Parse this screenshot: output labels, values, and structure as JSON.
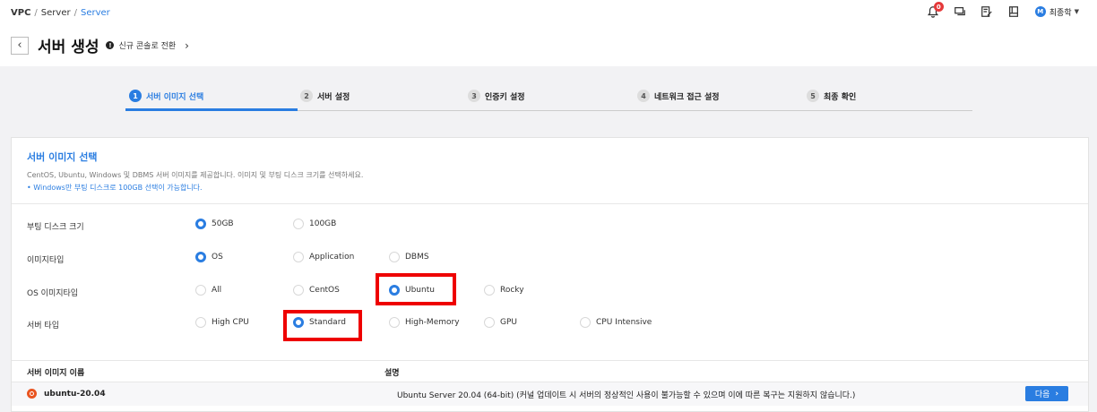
{
  "breadcrumb": {
    "items": [
      "VPC",
      "Server",
      "Server"
    ],
    "separator": "/"
  },
  "header": {
    "title": "서버 생성",
    "console_link": "신규 콘솔로 전환"
  },
  "topbar": {
    "notification_count": "0",
    "user_initial": "M",
    "user_name": "최종학"
  },
  "steps": [
    {
      "num": "1",
      "label": "서버 이미지 선택"
    },
    {
      "num": "2",
      "label": "서버 설정"
    },
    {
      "num": "3",
      "label": "인증키 설정"
    },
    {
      "num": "4",
      "label": "네트워크 접근 설정"
    },
    {
      "num": "5",
      "label": "최종 확인"
    }
  ],
  "section": {
    "title": "서버 이미지 선택",
    "description": "CentOS, Ubuntu, Windows 및 DBMS 서버 이미지를 제공합니다. 이미지 및 부팅 디스크 크기를 선택하세요.",
    "note": "• Windows만 부팅 디스크로 100GB 선택이 가능합니다."
  },
  "form": {
    "disk": {
      "label": "부팅 디스크 크기",
      "options": [
        "50GB",
        "100GB"
      ],
      "selected": "50GB"
    },
    "image_type": {
      "label": "이미지타입",
      "options": [
        "OS",
        "Application",
        "DBMS"
      ],
      "selected": "OS"
    },
    "os_type": {
      "label": "OS 이미지타입",
      "options": [
        "All",
        "CentOS",
        "Ubuntu",
        "Rocky"
      ],
      "selected": "Ubuntu"
    },
    "server_type": {
      "label": "서버 타입",
      "options": [
        "High CPU",
        "Standard",
        "High-Memory",
        "GPU",
        "CPU Intensive"
      ],
      "selected": "Standard"
    }
  },
  "table": {
    "headers": [
      "서버 이미지 이름",
      "설명"
    ],
    "rows": [
      {
        "name": "ubuntu-20.04",
        "description": "Ubuntu Server 20.04 (64-bit) (커널 업데이트 시 서버의 정상적인 사용이 불가능할 수 있으며 이에 따른 복구는 지원하지 않습니다.)",
        "action": "다음"
      }
    ]
  },
  "colors": {
    "accent": "#2a7de1",
    "highlight": "#e00000",
    "badge": "#e5393a",
    "ubuntu": "#e95420"
  }
}
